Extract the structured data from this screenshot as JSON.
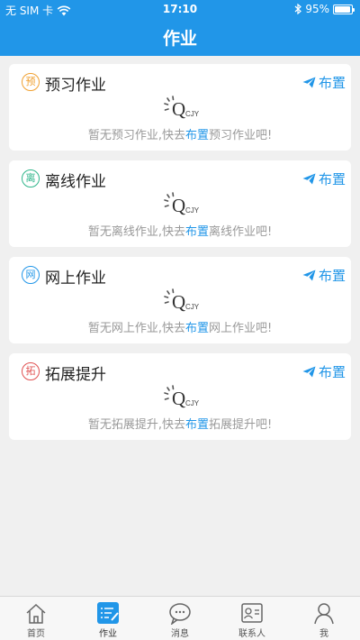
{
  "status_bar": {
    "carrier": "无 SIM 卡",
    "time": "17:10",
    "battery": "95%",
    "battery_level": 0.95
  },
  "nav": {
    "title": "作业"
  },
  "cards": [
    {
      "badge": "预",
      "badge_color": "#f0a030",
      "title": "预习作业",
      "assign_label": "布置",
      "empty_prefix": "暂无预习作业,快去",
      "empty_link": "布置",
      "empty_suffix": "预习作业吧!"
    },
    {
      "badge": "离",
      "badge_color": "#2fb58a",
      "title": "离线作业",
      "assign_label": "布置",
      "empty_prefix": "暂无离线作业,快去",
      "empty_link": "布置",
      "empty_suffix": "离线作业吧!"
    },
    {
      "badge": "网",
      "badge_color": "#2196e8",
      "title": "网上作业",
      "assign_label": "布置",
      "empty_prefix": "暂无网上作业,快去",
      "empty_link": "布置",
      "empty_suffix": "网上作业吧!"
    },
    {
      "badge": "拓",
      "badge_color": "#e05050",
      "title": "拓展提升",
      "assign_label": "布置",
      "empty_prefix": "暂无拓展提升,快去",
      "empty_link": "布置",
      "empty_suffix": "拓展提升吧!"
    }
  ],
  "logo_text": {
    "q": "Q",
    "suffix": "CJY"
  },
  "tabbar": {
    "items": [
      {
        "label": "首页",
        "icon": "home-icon"
      },
      {
        "label": "作业",
        "icon": "homework-icon",
        "active": true
      },
      {
        "label": "消息",
        "icon": "message-icon"
      },
      {
        "label": "联系人",
        "icon": "contacts-icon"
      },
      {
        "label": "我",
        "icon": "profile-icon"
      }
    ]
  },
  "colors": {
    "accent": "#2196e8",
    "background": "#f0f0f0"
  }
}
